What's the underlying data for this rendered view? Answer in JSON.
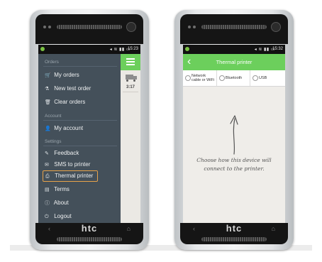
{
  "phones": {
    "brand": "htc",
    "nav_back": "‹",
    "nav_home": "⌂"
  },
  "left": {
    "status": {
      "icons": "◂ ≋ ▮▮ ▭",
      "time": "15:23"
    },
    "content": {
      "time": "3:17"
    },
    "drawer": {
      "sections": [
        {
          "title": "Orders"
        },
        {
          "title": "Account"
        },
        {
          "title": "Settings"
        }
      ],
      "items": [
        {
          "label": "My orders",
          "icon": "cart-icon",
          "glyph": "🛒"
        },
        {
          "label": "New test order",
          "icon": "flask-icon",
          "glyph": "⚗"
        },
        {
          "label": "Clear orders",
          "icon": "trash-icon",
          "glyph": "🗑"
        },
        {
          "label": "My account",
          "icon": "person-icon",
          "glyph": "👤"
        },
        {
          "label": "Feedback",
          "icon": "pencil-icon",
          "glyph": "✎"
        },
        {
          "label": "SMS to printer",
          "icon": "message-icon",
          "glyph": "✉"
        },
        {
          "label": "Thermal printer",
          "icon": "printer-icon",
          "glyph": "⎙"
        },
        {
          "label": "Terms",
          "icon": "document-icon",
          "glyph": "▤"
        },
        {
          "label": "About",
          "icon": "info-icon",
          "glyph": "ⓘ"
        },
        {
          "label": "Logout",
          "icon": "power-icon",
          "glyph": "⏻"
        }
      ],
      "active_item": "Thermal printer"
    }
  },
  "right": {
    "status": {
      "icons": "◂ ≋ ▮▮ ▭",
      "time": "15:32"
    },
    "header": {
      "title": "Thermal printer",
      "back_glyph": "‹"
    },
    "options": [
      {
        "line1": "Network",
        "line2": "cable or WiFi"
      },
      {
        "line1": "Bluetooth"
      },
      {
        "line1": "USB"
      }
    ],
    "hint": "Choose how this device will connect to the printer."
  },
  "colors": {
    "accent_green": "#6ccf5c",
    "drawer_bg": "#44505a",
    "highlight_border": "#e8a34a"
  }
}
